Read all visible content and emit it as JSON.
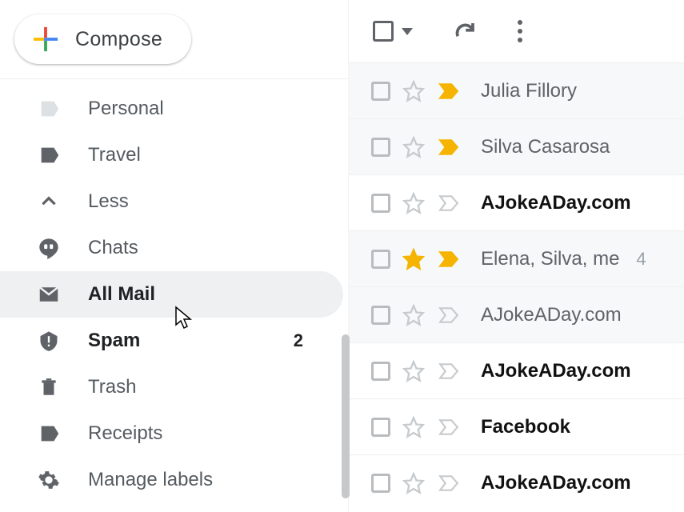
{
  "compose": {
    "label": "Compose"
  },
  "sidebar": {
    "items": [
      {
        "label": "Personal",
        "count": null,
        "bold": false,
        "active": false
      },
      {
        "label": "Travel",
        "count": null,
        "bold": false,
        "active": false
      },
      {
        "label": "Less",
        "count": null,
        "bold": false,
        "active": false
      },
      {
        "label": "Chats",
        "count": null,
        "bold": false,
        "active": false
      },
      {
        "label": "All Mail",
        "count": null,
        "bold": true,
        "active": true
      },
      {
        "label": "Spam",
        "count": "2",
        "bold": true,
        "active": false
      },
      {
        "label": "Trash",
        "count": null,
        "bold": false,
        "active": false
      },
      {
        "label": "Receipts",
        "count": null,
        "bold": false,
        "active": false
      },
      {
        "label": "Manage labels",
        "count": null,
        "bold": false,
        "active": false
      }
    ]
  },
  "messages": [
    {
      "sender": "Julia Fillory",
      "bold": false,
      "starred": false,
      "important": true,
      "shaded": true,
      "threadcount": null
    },
    {
      "sender": "Silva Casarosa",
      "bold": false,
      "starred": false,
      "important": true,
      "shaded": true,
      "threadcount": null
    },
    {
      "sender": "AJokeADay.com",
      "bold": true,
      "starred": false,
      "important": false,
      "shaded": false,
      "threadcount": null
    },
    {
      "sender": "Elena, Silva, me",
      "bold": false,
      "starred": true,
      "important": true,
      "shaded": true,
      "threadcount": "4"
    },
    {
      "sender": "AJokeADay.com",
      "bold": false,
      "starred": false,
      "important": false,
      "shaded": true,
      "threadcount": null
    },
    {
      "sender": "AJokeADay.com",
      "bold": true,
      "starred": false,
      "important": false,
      "shaded": false,
      "threadcount": null
    },
    {
      "sender": "Facebook",
      "bold": true,
      "starred": false,
      "important": false,
      "shaded": false,
      "threadcount": null
    },
    {
      "sender": "AJokeADay.com",
      "bold": true,
      "starred": false,
      "important": false,
      "shaded": false,
      "threadcount": null
    }
  ]
}
